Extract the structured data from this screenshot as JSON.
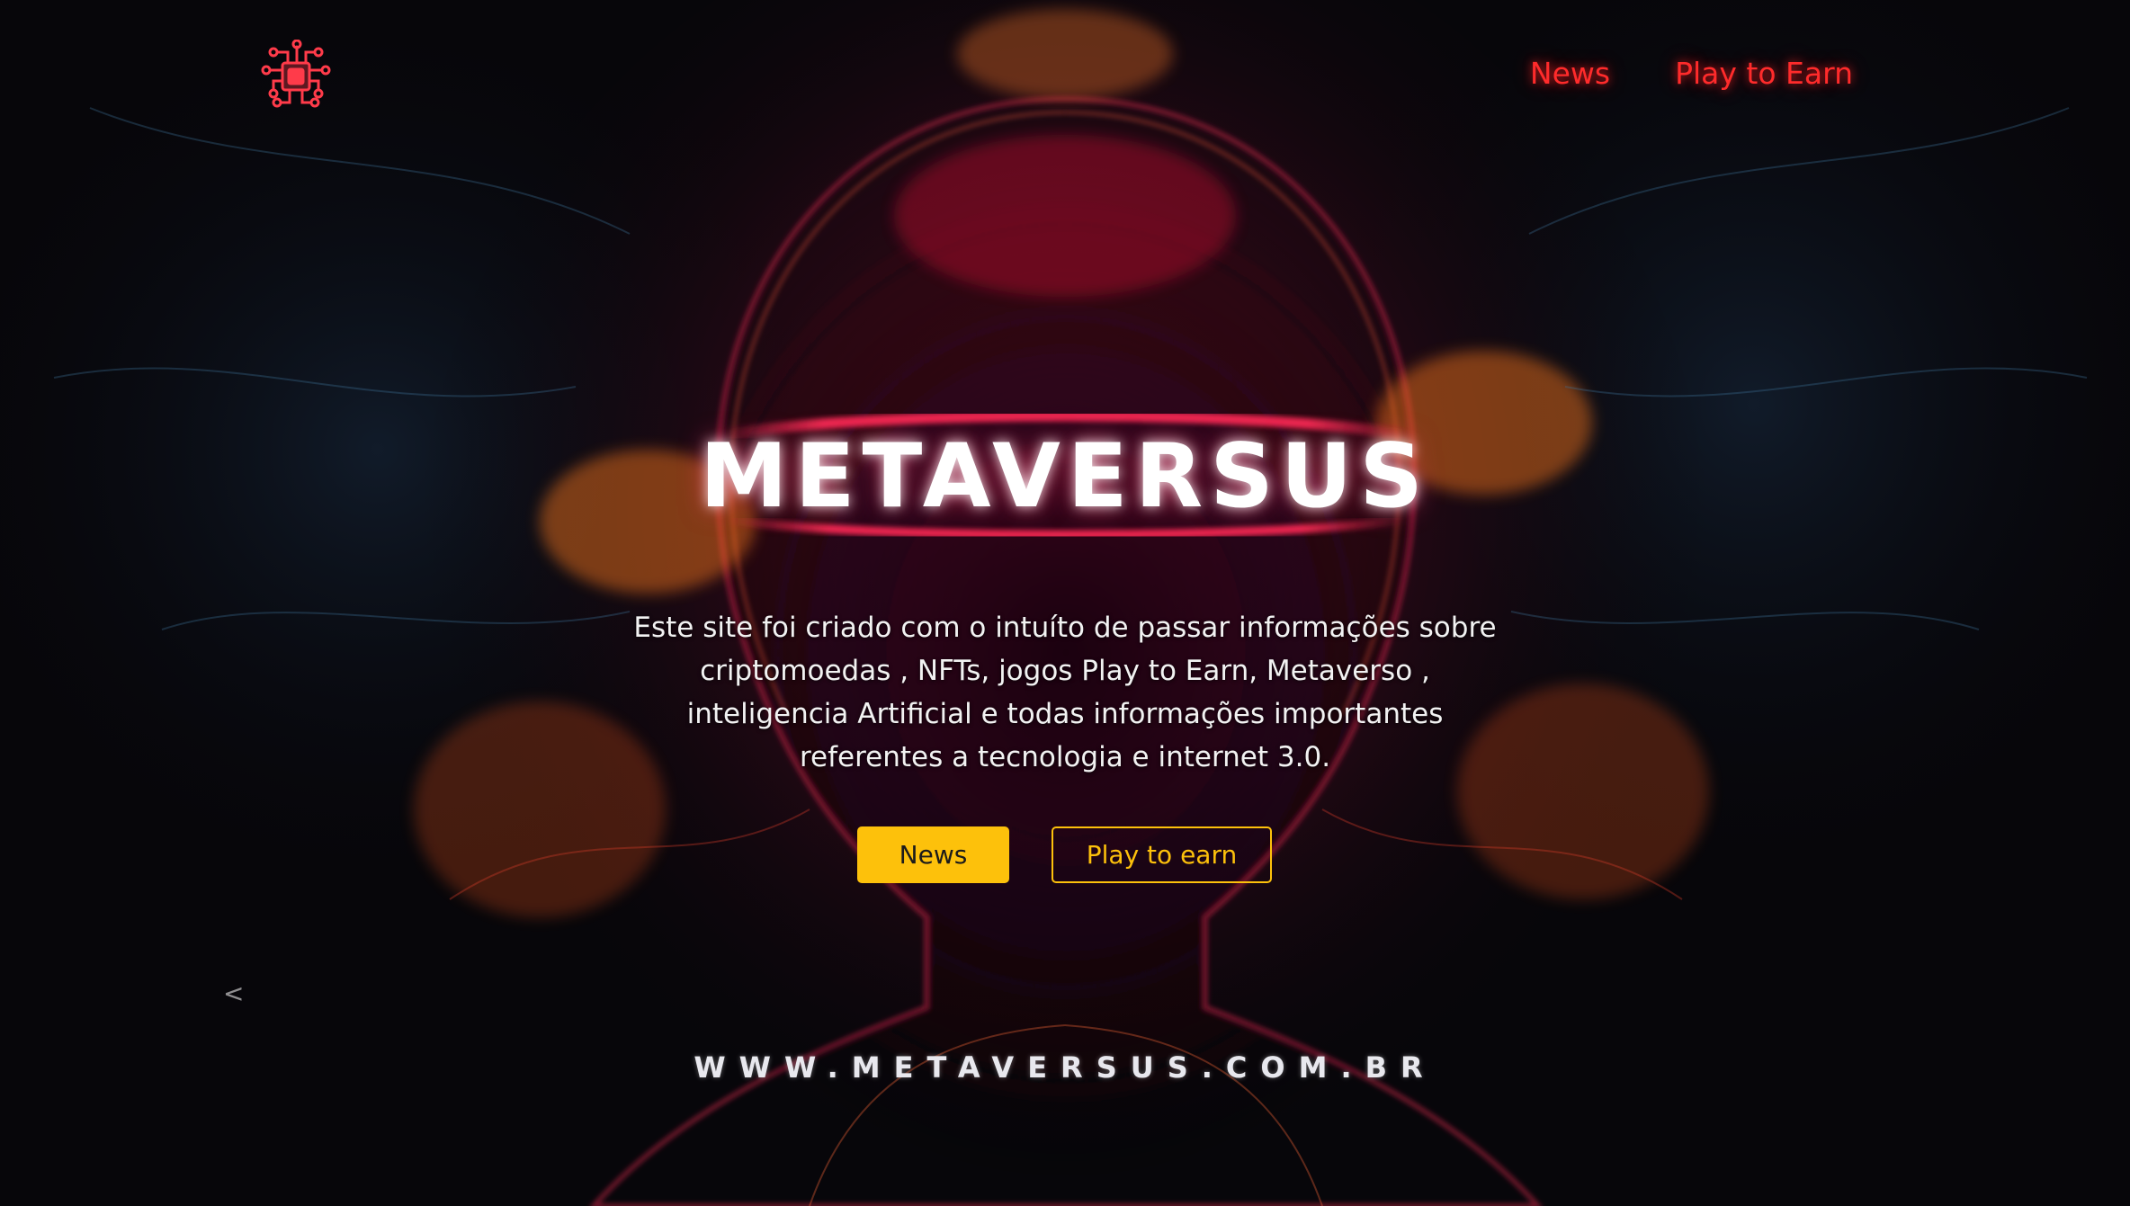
{
  "header": {
    "logo_icon": "circuit-chip-icon",
    "nav": [
      {
        "label": "News"
      },
      {
        "label": "Play to Earn"
      }
    ]
  },
  "hero": {
    "title": "METAVERSUS",
    "description": "Este site foi criado com o intuíto de passar informações sobre criptomoedas , NFTs, jogos Play to Earn, Metaverso , inteligencia Artificial e todas informações importantes referentes a tecnologia e internet 3.0.",
    "buttons": {
      "news": "News",
      "play": "Play to earn"
    },
    "prev_arrow": "<",
    "url": "WWW.METAVERSUS.COM.BR"
  },
  "colors": {
    "accent_red": "#ff2b2b",
    "button_yellow": "#fdc10b",
    "background": "#07060a"
  }
}
